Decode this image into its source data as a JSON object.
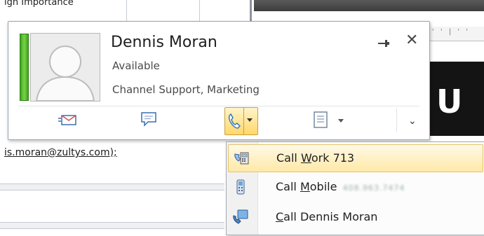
{
  "background": {
    "importance_text": "igh Importance",
    "email_fragment": "is.moran@zultys.com);",
    "doc_letter": "U"
  },
  "contact_card": {
    "name": "Dennis Moran",
    "status": "Available",
    "department": "Channel Support, Marketing",
    "presence_color": "#4cbb2a",
    "icons": {
      "pin": "pin-icon",
      "close": "close-icon",
      "email": "email-icon",
      "im": "instant-message-icon",
      "call": "phone-icon",
      "schedule": "schedule-icon",
      "expand": "chevron-down-icon"
    },
    "close_glyph": "✕",
    "expand_glyph": "⌄"
  },
  "call_menu": {
    "items": [
      {
        "prefix": "Call ",
        "accel": "W",
        "suffix": "ork 713",
        "icon": "work-phone-icon",
        "selected": true
      },
      {
        "prefix": "Call ",
        "accel": "M",
        "suffix": "obile",
        "icon": "mobile-phone-icon",
        "selected": false,
        "blurred_number": "408.963.7474"
      },
      {
        "prefix": "",
        "accel": "C",
        "suffix": "all Dennis Moran",
        "icon": "lync-call-icon",
        "selected": false
      }
    ]
  },
  "colors": {
    "accent_yellow": "#ffd86a",
    "selection_border": "#e6c36a",
    "card_border": "#9aa4b1"
  }
}
